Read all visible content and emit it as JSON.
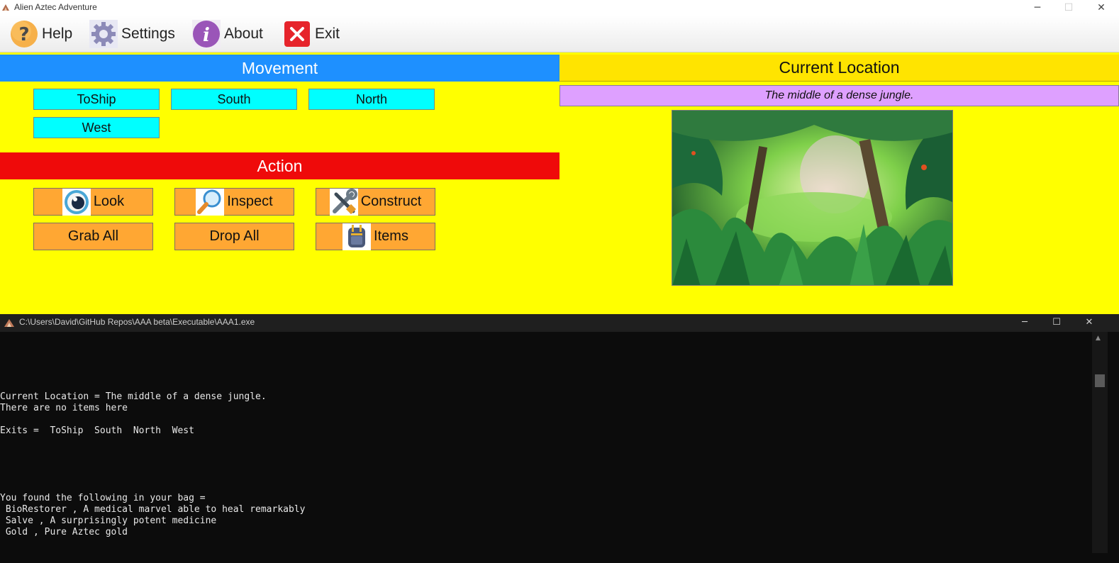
{
  "app": {
    "title": "Alien Aztec Adventure",
    "window_controls": [
      "─",
      "☐",
      "✕"
    ]
  },
  "menu": {
    "items": [
      {
        "label": "Help",
        "icon": "help-icon"
      },
      {
        "label": "Settings",
        "icon": "gear-icon"
      },
      {
        "label": "About",
        "icon": "info-icon"
      },
      {
        "label": "Exit",
        "icon": "close-icon"
      }
    ]
  },
  "movement": {
    "header": "Movement",
    "header_color": "#1e90ff",
    "buttons": [
      "ToShip",
      "South",
      "North",
      "West"
    ]
  },
  "action": {
    "header": "Action",
    "header_color": "#ef0a0a",
    "buttons": [
      {
        "label": "Look",
        "icon": "eye-icon"
      },
      {
        "label": "Inspect",
        "icon": "magnifier-icon"
      },
      {
        "label": "Construct",
        "icon": "tools-icon"
      },
      {
        "label": "Grab All",
        "icon": ""
      },
      {
        "label": "Drop All",
        "icon": ""
      },
      {
        "label": "Items",
        "icon": "backpack-icon"
      }
    ]
  },
  "location": {
    "header": "Current Location",
    "header_color": "#ffe400",
    "description": "The middle of a dense jungle.",
    "image": "jungle-scene"
  },
  "console": {
    "title": "C:\\Users\\David\\GitHub Repos\\AAA beta\\Executable\\AAA1.exe",
    "lines": [
      "Current Location = The middle of a dense jungle.",
      "There are no items here",
      "Exits =  ToShip  South  North  West",
      "You found the following in your bag =",
      " BioRestorer , A medical marvel able to heal remarkably",
      " Salve , A surprisingly potent medicine",
      " Gold , Pure Aztec gold"
    ]
  }
}
